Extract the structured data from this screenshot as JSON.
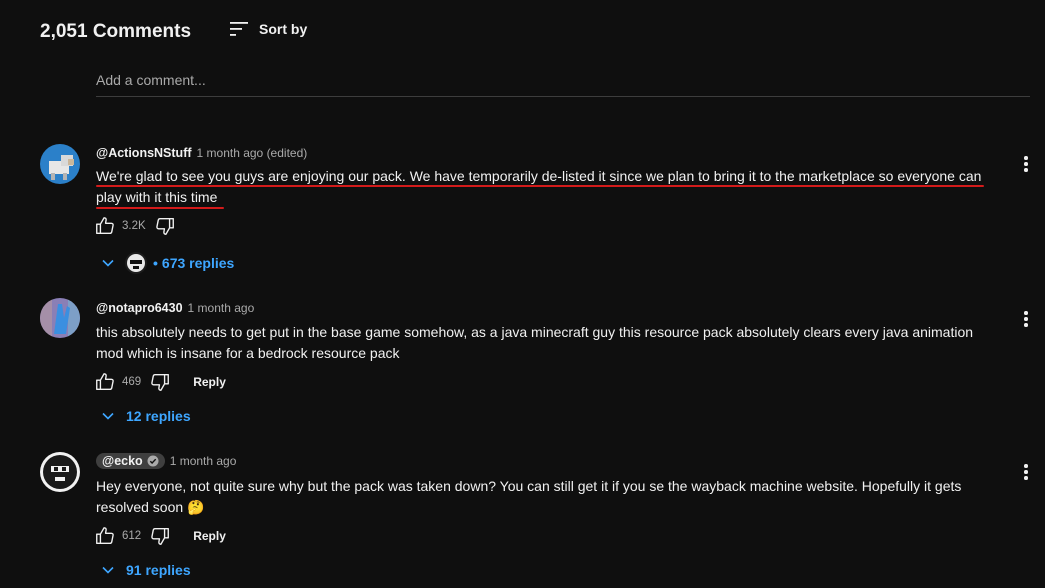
{
  "header": {
    "comment_count": "2,051 Comments",
    "sort_label": "Sort by"
  },
  "composer": {
    "placeholder": "Add a comment..."
  },
  "comments": [
    {
      "author": "@ActionsNStuff",
      "time": "1 month ago (edited)",
      "text": "We're glad to see you guys are enjoying our pack. We have temporarily de-listed it since we plan to bring it to the marketplace so everyone can play with it this time",
      "likes": "3.2K",
      "replies": "673 replies",
      "avatar_icon": "sheep-avatar-icon",
      "has_creator_reply": true,
      "highlighted": true
    },
    {
      "author": "@notapro6430",
      "time": "1 month ago",
      "text": "this absolutely needs to get put in the base game somehow, as a java minecraft guy this resource pack absolutely clears every java animation mod which is insane for a bedrock resource pack",
      "likes": "469",
      "reply_label": "Reply",
      "replies": "12 replies",
      "avatar_icon": "blue-figure-avatar-icon"
    },
    {
      "author": "@ecko",
      "time": "1 month ago",
      "text": "Hey everyone, not quite sure why but the pack was taken down? You can still get it if you se the wayback machine website. Hopefully it gets resolved soon",
      "emoji": "🤔",
      "likes": "612",
      "reply_label": "Reply",
      "replies": "91 replies",
      "verified": true,
      "avatar_icon": "mask-avatar-icon"
    }
  ],
  "colors": {
    "background": "#0f0f0f",
    "text": "#f1f1f1",
    "secondary_text": "#aaaaaa",
    "link_blue": "#3ea6ff",
    "highlight_red": "#d31a1a"
  }
}
